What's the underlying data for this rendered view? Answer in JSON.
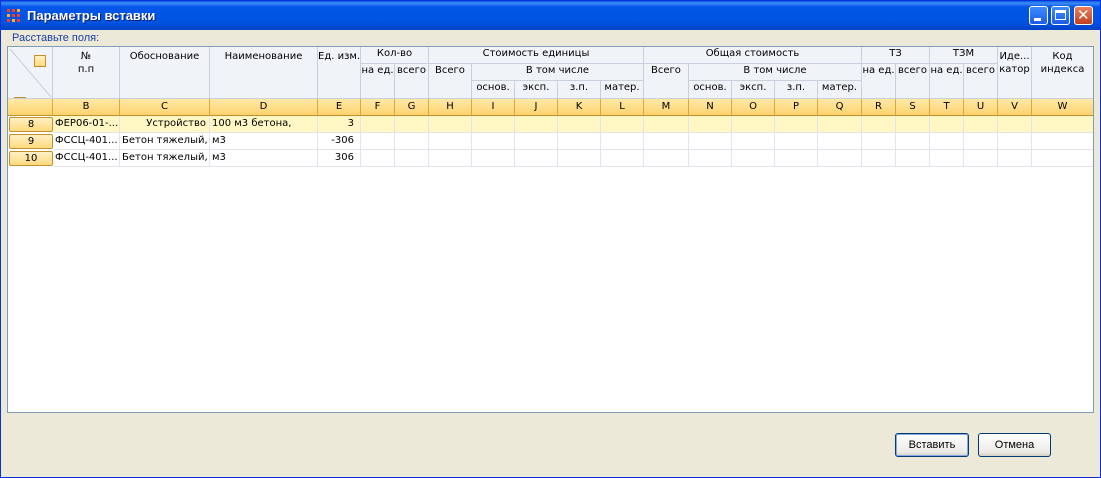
{
  "window": {
    "title": "Параметры вставки"
  },
  "instruction": "Расставьте поля:",
  "header": {
    "num_top": "№",
    "num_bottom": "п.п",
    "basis": "Обоснование",
    "name": "Наименование",
    "unit": "Ед. изм.",
    "qty": "Кол-во",
    "qty_per_unit": "на ед.",
    "qty_total": "всего",
    "unit_cost": "Стоимость единицы",
    "unit_cost_total": "Всего",
    "including": "В том числе",
    "sub_main": "основ.",
    "sub_exp": "эксп.",
    "sub_wage": "з.п.",
    "sub_mat": "матер.",
    "total_cost": "Общая стоимость",
    "total_cost_total": "Всего",
    "including2": "В том числе",
    "tz": "ТЗ",
    "tz_per_unit": "на ед.",
    "tz_total": "всего",
    "tzm": "ТЗМ",
    "tzm_per_unit": "на ед.",
    "tzm_total": "всего",
    "ident_top": "Иде...",
    "ident_bottom": "катор",
    "index_top": "Код",
    "index_bottom": "индекса"
  },
  "letters": [
    "B",
    "C",
    "D",
    "E",
    "F",
    "G",
    "H",
    "I",
    "J",
    "K",
    "L",
    "M",
    "N",
    "O",
    "P",
    "Q",
    "R",
    "S",
    "T",
    "U",
    "V",
    "W"
  ],
  "rows": [
    {
      "num": "8",
      "basis": "ФЕР06-01-...",
      "name_prefix": "Устройство",
      "name": "100 м3 бетона,",
      "unit": "3"
    },
    {
      "num": "9",
      "basis": "ФССЦ-401...",
      "name_prefix": "Бетон тяжелый,",
      "name": "м3",
      "unit": "-306"
    },
    {
      "num": "10",
      "basis": "ФССЦ-401...",
      "name_prefix": "Бетон тяжелый,",
      "name": "м3",
      "unit": "306"
    }
  ],
  "buttons": {
    "insert": "Вставить",
    "cancel": "Отмена"
  }
}
